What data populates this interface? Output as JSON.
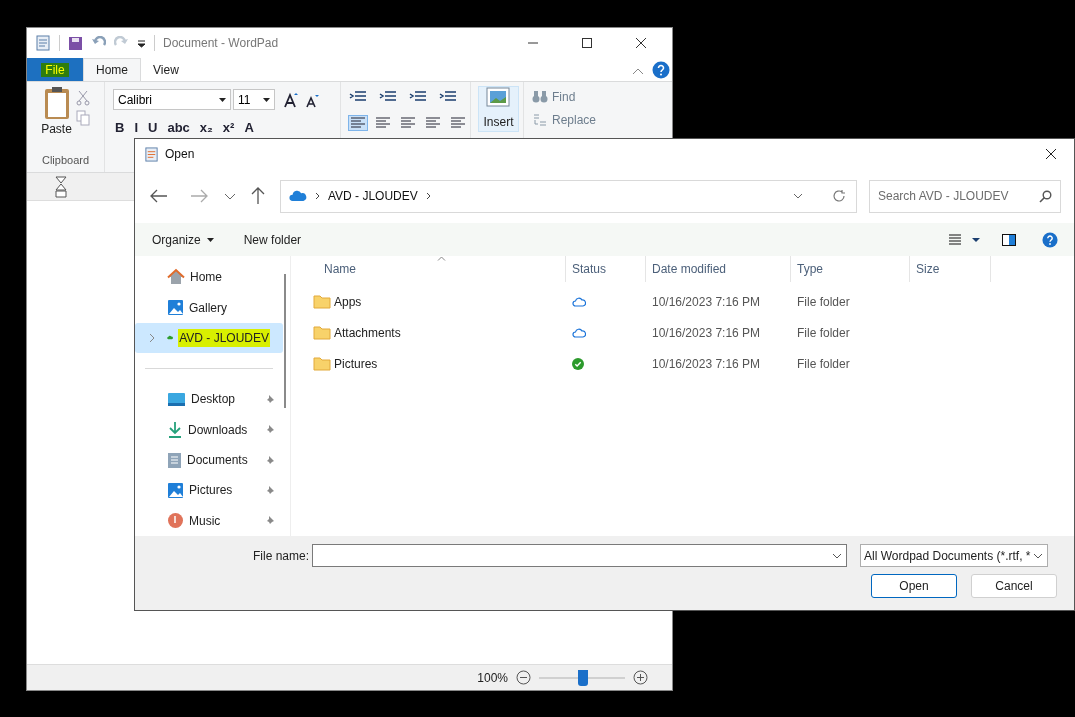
{
  "wordpad": {
    "title": "Document - WordPad",
    "tabs": [
      {
        "label": "File",
        "selected": false,
        "kind": "file"
      },
      {
        "label": "Home",
        "selected": true,
        "kind": "tab"
      },
      {
        "label": "View",
        "selected": false,
        "kind": "tab"
      }
    ],
    "font": {
      "family": "Calibri",
      "size": "11"
    },
    "format_buttons": [
      "B",
      "I",
      "U",
      "abc",
      "x₂",
      "x²",
      "A"
    ],
    "paste": "Paste",
    "clipboard": "Clipboard",
    "insert": "Insert",
    "find": "Find",
    "replace": "Replace",
    "zoom": {
      "reading": "100%",
      "level": 0.51
    }
  },
  "dialog": {
    "title": "Open",
    "breadcrumb": "AVD - JLOUDEV",
    "search": {
      "placeholder": "Search AVD - JLOUDEV"
    },
    "commands": [
      "Organize",
      "New folder"
    ],
    "sidebar": [
      {
        "label": "Home",
        "selected": false,
        "pinned": false
      },
      {
        "label": "Gallery",
        "selected": false,
        "pinned": false
      },
      {
        "label": "AVD - JLOUDEV",
        "selected": true,
        "pinned": false
      },
      {
        "label": "Desktop",
        "selected": false,
        "pinned": true
      },
      {
        "label": "Downloads",
        "selected": false,
        "pinned": true
      },
      {
        "label": "Documents",
        "selected": false,
        "pinned": true
      },
      {
        "label": "Pictures",
        "selected": false,
        "pinned": true
      },
      {
        "label": "Music",
        "selected": false,
        "pinned": true
      }
    ],
    "columns": [
      "Name",
      "Status",
      "Date modified",
      "Type",
      "Size"
    ],
    "rows": [
      {
        "name": "Apps",
        "synced": false,
        "date": "10/16/2023 7:16 PM",
        "type": "File folder"
      },
      {
        "name": "Attachments",
        "synced": false,
        "date": "10/16/2023 7:16 PM",
        "type": "File folder"
      },
      {
        "name": "Pictures",
        "synced": true,
        "date": "10/16/2023 7:16 PM",
        "type": "File folder"
      }
    ],
    "file_name_label": "File name:",
    "filter": "All Wordpad Documents (*.rtf, *",
    "buttons": [
      "Open",
      "Cancel"
    ]
  }
}
